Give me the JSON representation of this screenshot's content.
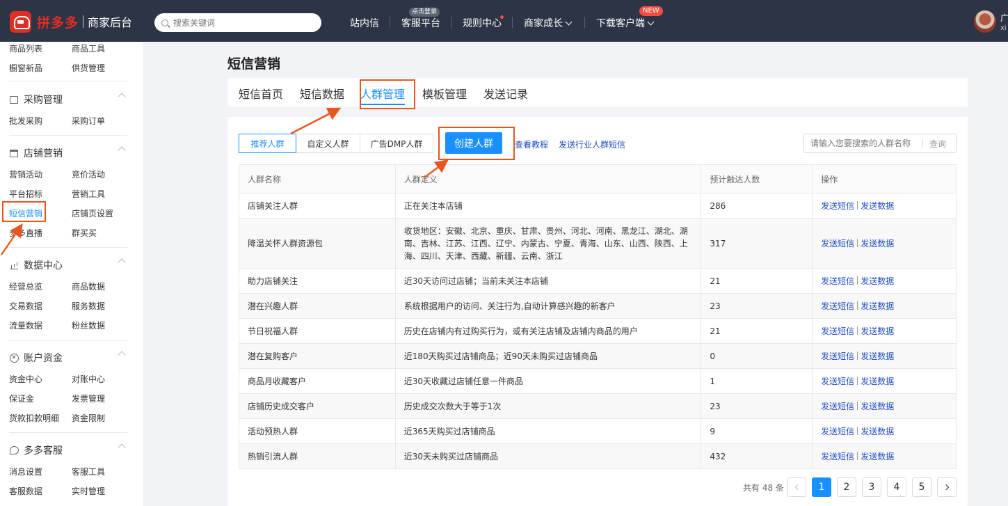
{
  "topbar": {
    "brand": "拼多多",
    "brand_sub": "商家后台",
    "search_placeholder": "搜索关键词",
    "nav": [
      "站内信",
      "客服平台",
      "规则中心",
      "商家成长",
      "下载客户端"
    ],
    "login_badge": "点击登录",
    "new_badge": "NEW",
    "user_line1": "广",
    "user_line2": "xi"
  },
  "sidebar": {
    "top_links": [
      [
        "商品列表",
        "商品工具"
      ],
      [
        "橱窗新品",
        "供货管理"
      ]
    ],
    "groups": [
      {
        "title": "采购管理",
        "icon": "clipboard-icon",
        "links": [
          [
            "批发采购",
            "采购订单"
          ]
        ]
      },
      {
        "title": "店铺营销",
        "icon": "store-icon",
        "links": [
          [
            "营销活动",
            "竞价活动"
          ],
          [
            "平台招标",
            "营销工具"
          ],
          [
            "短信营销",
            "店铺页设置"
          ],
          [
            "多多直播",
            "群买买"
          ]
        ]
      },
      {
        "title": "数据中心",
        "icon": "bar-chart-icon",
        "links": [
          [
            "经营总览",
            "商品数据"
          ],
          [
            "交易数据",
            "服务数据"
          ],
          [
            "流量数据",
            "粉丝数据"
          ]
        ]
      },
      {
        "title": "账户资金",
        "icon": "yen-coin-icon",
        "links": [
          [
            "资金中心",
            "对账中心"
          ],
          [
            "保证金",
            "发票管理"
          ],
          [
            "货款扣款明细",
            "资金限制"
          ]
        ]
      },
      {
        "title": "多多客服",
        "icon": "chat-icon",
        "links": [
          [
            "消息设置",
            "客服工具"
          ],
          [
            "客服数据",
            "实时管理"
          ]
        ]
      }
    ],
    "active_item": "短信营销"
  },
  "page": {
    "title": "短信营销",
    "tabs": [
      "短信首页",
      "短信数据",
      "人群管理",
      "模板管理",
      "发送记录"
    ],
    "active_tab": "人群管理"
  },
  "toolbar": {
    "segments": [
      "推荐人群",
      "自定义人群",
      "广告DMP人群"
    ],
    "create_button": "创建人群",
    "links": [
      "查看教程",
      "发送行业人群短信"
    ],
    "search_placeholder": "请输入您要搜索的人群名称",
    "search_button": "查询"
  },
  "table": {
    "headers": [
      "人群名称",
      "人群定义",
      "预计触达人数",
      "操作"
    ],
    "rows": [
      {
        "name": "店铺关注人群",
        "def": "正在关注本店铺",
        "count": "286"
      },
      {
        "name": "降温关怀人群资源包",
        "def": "收货地区：安徽、北京、重庆、甘肃、贵州、河北、河南、黑龙江、湖北、湖南、吉林、江苏、江西、辽宁、内蒙古、宁夏、青海、山东、山西、陕西、上海、四川、天津、西藏、新疆、云南、浙江",
        "count": "317"
      },
      {
        "name": "助力店铺关注",
        "def": "近30天访问过店铺；当前未关注本店铺",
        "count": "21"
      },
      {
        "name": "潜在兴趣人群",
        "def": "系统根据用户的访问、关注行为,自动计算感兴趣的新客户",
        "count": "23"
      },
      {
        "name": "节日祝福人群",
        "def": "历史在店铺内有过购买行为，或有关注店铺及店铺内商品的用户",
        "count": "21"
      },
      {
        "name": "潜在复购客户",
        "def": "近180天购买过店铺商品；近90天未购买过店铺商品",
        "count": "0"
      },
      {
        "name": "商品月收藏客户",
        "def": "近30天收藏过店铺任意一件商品",
        "count": "1"
      },
      {
        "name": "店铺历史成交客户",
        "def": "历史成交次数大于等于1次",
        "count": "23"
      },
      {
        "name": "活动预热人群",
        "def": "近365天购买过店铺商品",
        "count": "9"
      },
      {
        "name": "热销引流人群",
        "def": "近30天未购买过店铺商品",
        "count": "432"
      }
    ],
    "op_send_sms": "发送短信",
    "op_send_data": "发送数据"
  },
  "pagination": {
    "total": "共有 48 条",
    "pages": [
      "1",
      "2",
      "3",
      "4",
      "5"
    ],
    "current": "1"
  },
  "colors": {
    "accent": "#1890ff",
    "topbar": "#2c3445",
    "brand_red": "#e02e24",
    "annotation": "#e8551f"
  }
}
